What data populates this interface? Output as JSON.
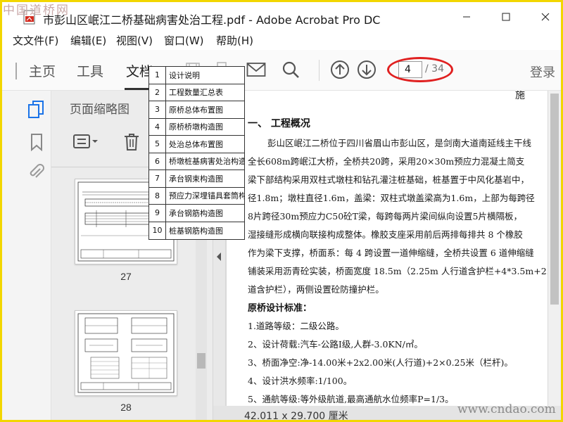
{
  "watermark": {
    "top": "中国道桥网",
    "bottom": "www.cndao.com"
  },
  "titlebar": {
    "title": "市彭山区岷江二桥基础病害处治工程.pdf - Adobe Acrobat Pro DC"
  },
  "menu": {
    "items": [
      "文件(F)",
      "编辑(E)",
      "视图(V)",
      "窗口(W)",
      "帮助(H)"
    ],
    "fragment": "文"
  },
  "toolbar": {
    "tabs": [
      "主页",
      "工具",
      "文档"
    ],
    "active_tab": "文档",
    "current_page": "4",
    "page_total": "/ 34",
    "signin": "登录"
  },
  "sidebar": {
    "panel_title": "页面缩略图",
    "thumbnails": [
      {
        "label": "27"
      },
      {
        "label": "28"
      }
    ]
  },
  "toc": [
    {
      "num": "1",
      "name": "设计说明"
    },
    {
      "num": "2",
      "name": "工程数量汇总表"
    },
    {
      "num": "3",
      "name": "原桥总体布置图"
    },
    {
      "num": "4",
      "name": "原桥桥墩构造图"
    },
    {
      "num": "5",
      "name": "处治总体布置图"
    },
    {
      "num": "6",
      "name": "桥墩桩基病害处治构造图"
    },
    {
      "num": "7",
      "name": "承台钢束构造图"
    },
    {
      "num": "8",
      "name": "预应力深埋锚具套筒构造图"
    },
    {
      "num": "9",
      "name": "承台钢筋构造图"
    },
    {
      "num": "10",
      "name": "桩基钢筋构造图"
    }
  ],
  "document": {
    "top_fragment": "施",
    "section_heading": "一、 工程概况",
    "para_lines": [
      "彭山区岷江二桥位于四川省眉山市彭山区，是剑南大道南延线主干线",
      "全长608m跨岷江大桥，全桥共20跨，采用20×30m预应力混凝土简支",
      "梁下部结构采用双柱式墩柱和钻孔灌注桩基础，桩基置于中风化基岩中，",
      "径1.8m；墩柱直径1.6m，盖梁：双柱式墩盖梁高为1.6m，上部为每跨径",
      "8片跨径30m预应力C50砼T梁，每跨每两片梁间纵向设置5片横隔板，",
      "湿接缝形成横向联接构成整体。橡胶支座采用前后两排每排共 8 个橡胶",
      "作为梁下支撑，桥面系：每 4 跨设置一道伸缩缝，全桥共设置 6 道伸缩缝",
      "铺装采用沥青砼实装，桥面宽度 18.5m（2.25m 人行道含护栏+4*3.5m+2.",
      "道含护栏），两侧设置砼防撞护栏。"
    ],
    "standards_heading": "原桥设计标准：",
    "standards": [
      "1.道路等级：二级公路。",
      "2、设计荷载:汽车-公路Ⅰ级,人群-3.0KN/㎡。",
      "3、桥面净空:净-14.00米+2x2.00米(人行道)+2×0.25米（栏杆)。",
      "4、设计洪水频率:1/100。",
      "5、通航等级:等外级航道,最高通航水位频率P=1/3。"
    ],
    "page_size": "42.011 x 29.700 厘米"
  }
}
